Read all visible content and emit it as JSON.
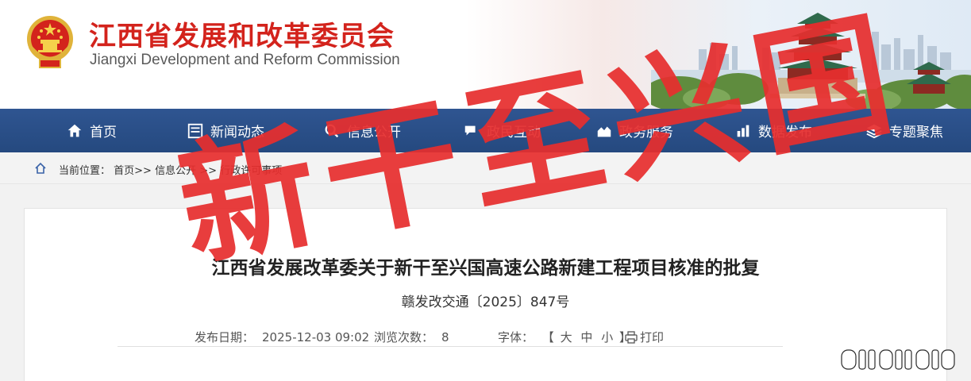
{
  "header": {
    "title_cn": "江西省发展和改革委员会",
    "title_en": "Jiangxi Development and Reform Commission"
  },
  "nav": {
    "items": [
      {
        "label": "首页",
        "icon": "home-icon"
      },
      {
        "label": "新闻动态",
        "icon": "news-icon"
      },
      {
        "label": "信息公开",
        "icon": "search-icon"
      },
      {
        "label": "政民互动",
        "icon": "interaction-icon"
      },
      {
        "label": "政务服务",
        "icon": "service-icon"
      },
      {
        "label": "数据发布",
        "icon": "data-icon"
      },
      {
        "label": "专题聚焦",
        "icon": "layers-icon"
      }
    ]
  },
  "breadcrumb": {
    "prefix": "当前位置：",
    "items": [
      "首页>>",
      "信息公开",
      ">>",
      "行政许可事项"
    ]
  },
  "article": {
    "title": "江西省发展改革委关于新干至兴国高速公路新建工程项目核准的批复",
    "doc_number": "赣发改交通〔2025〕847号",
    "date_label": "发布日期：",
    "date_value": "2025-12-03 09:02",
    "views_label": "浏览次数：",
    "views_value": "8",
    "font_label": "字体：",
    "font_open": "【",
    "font_large": "大",
    "font_medium": "中",
    "font_small": "小",
    "font_close": "】",
    "print_label": "打印"
  },
  "overlay": {
    "stamp_text": "新干至兴国"
  },
  "colors": {
    "title_red": "#d3231c",
    "nav_blue": "#2a4f8a",
    "stamp_red": "#e62e2e"
  }
}
